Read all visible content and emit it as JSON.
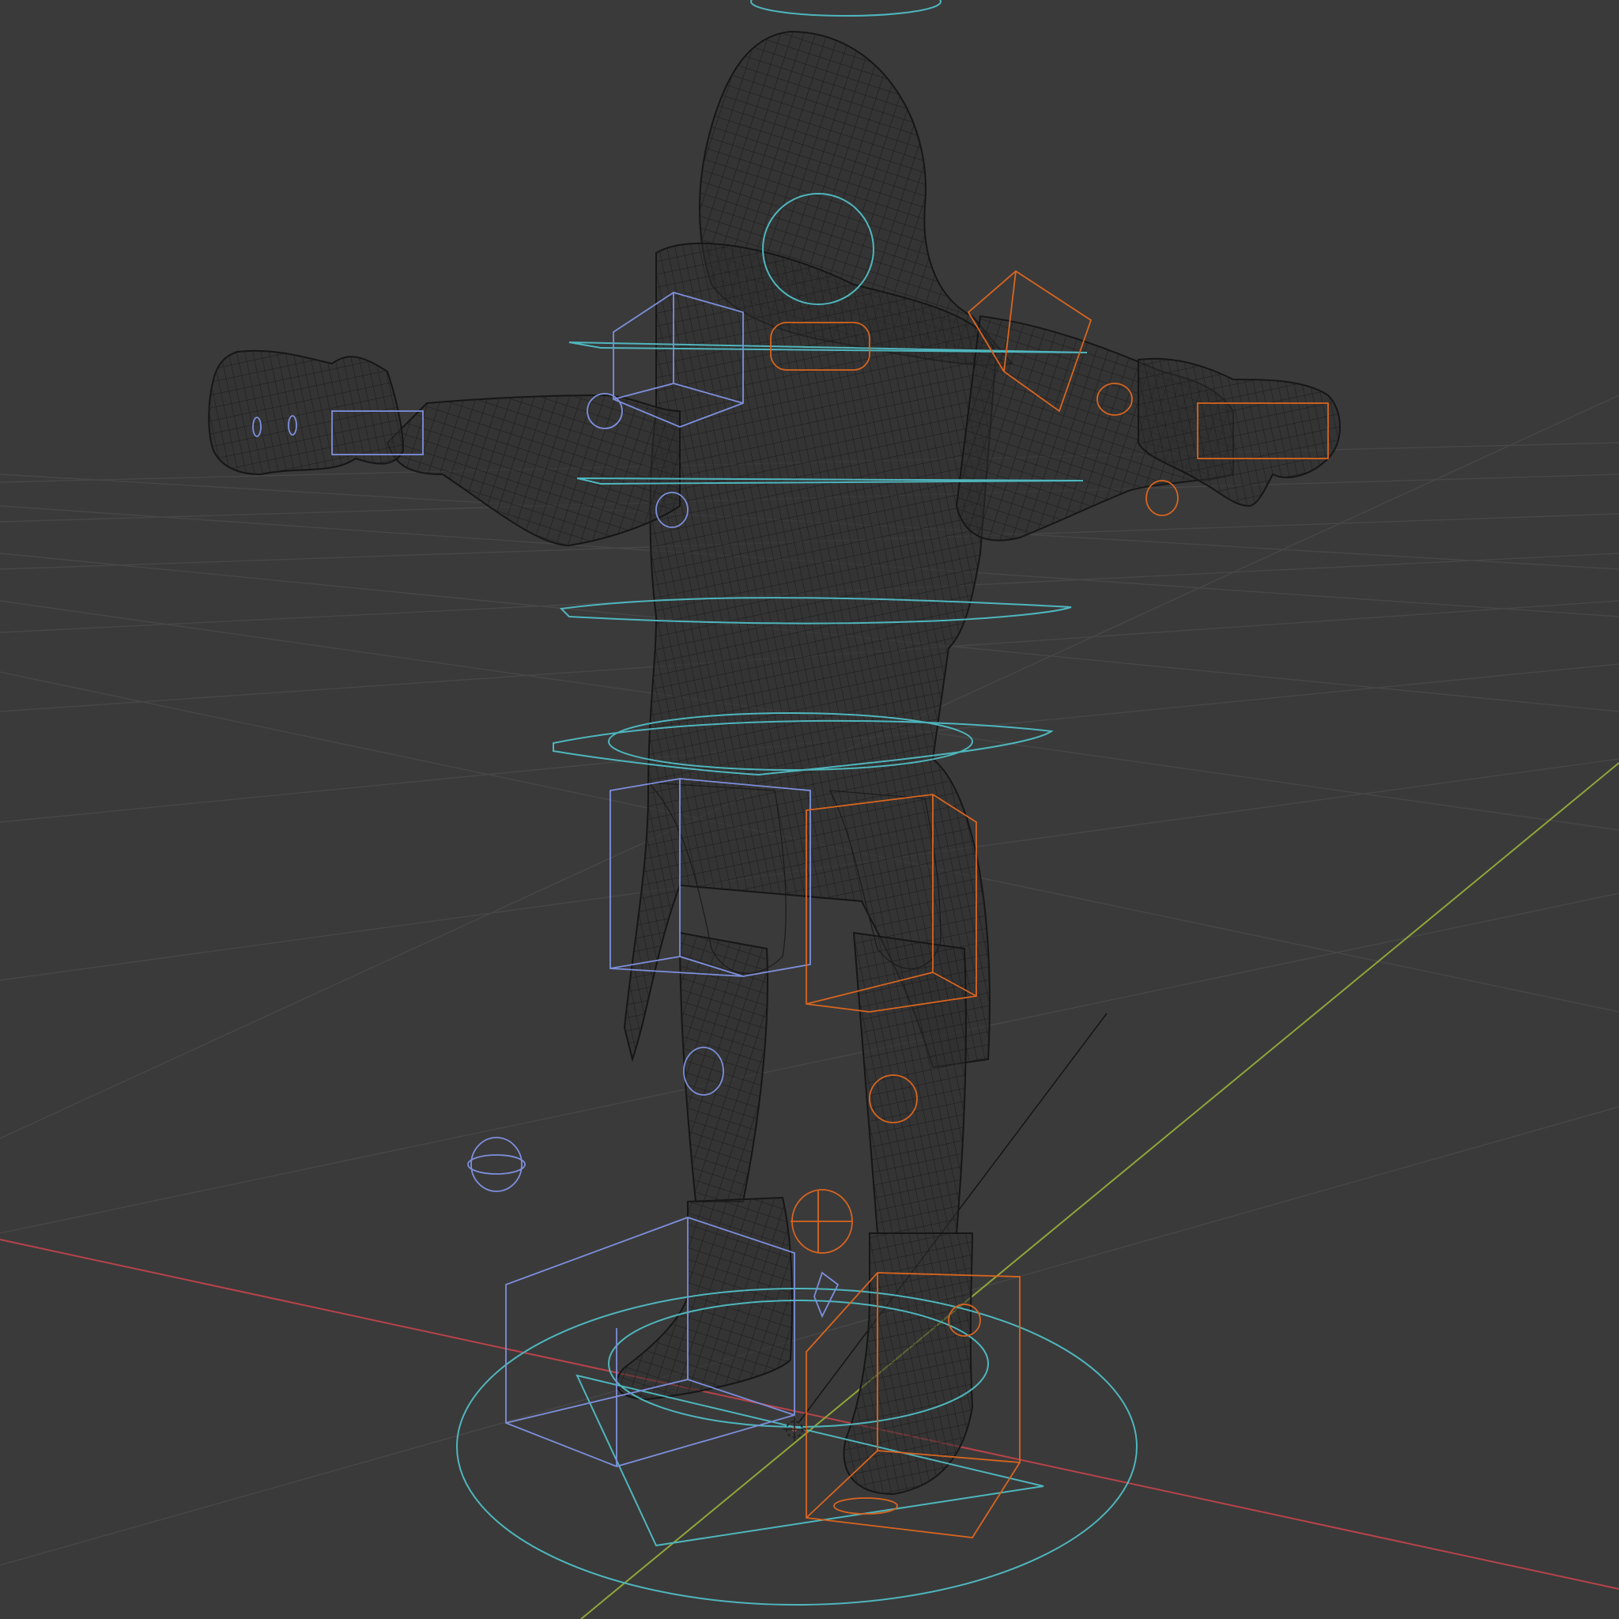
{
  "viewport": {
    "background": "#3a3a3a",
    "grid_color": "#4a4a4a",
    "x_axis_color": "#b8434a",
    "y_axis_color": "#8fa63a",
    "mesh_wire_color": "#1b1b1b",
    "center_controls_color": "#4fb6bd",
    "left_controls_color": "#7d8fdc",
    "right_controls_color": "#d9651f"
  },
  "scene": {
    "object": "character-wireframe",
    "mode": "wireframe",
    "visible_text": []
  }
}
